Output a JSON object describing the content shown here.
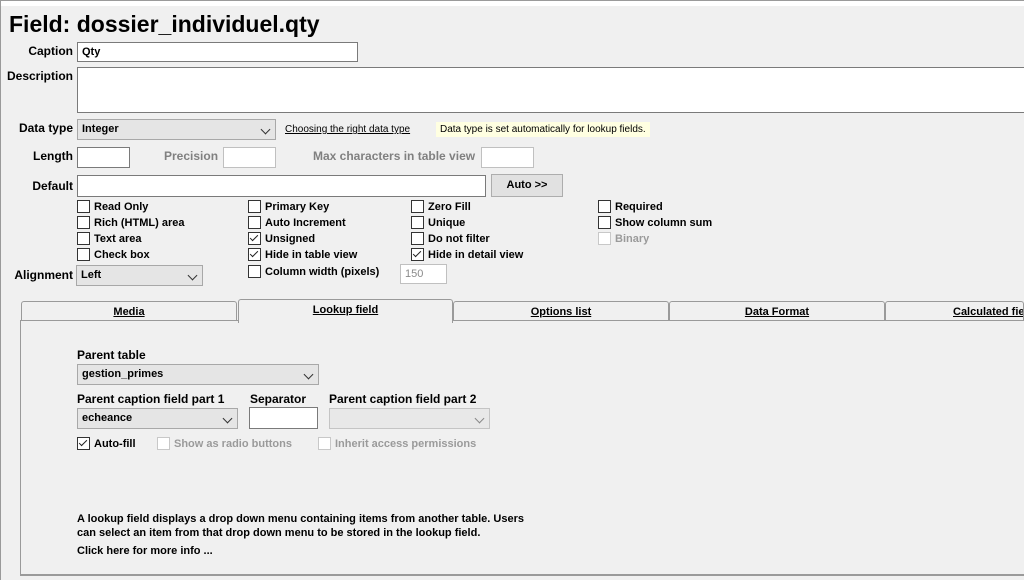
{
  "title": "Field: dossier_individuel.qty",
  "caption": {
    "label": "Caption",
    "value": "Qty"
  },
  "description": {
    "label": "Description",
    "value": ""
  },
  "data_type": {
    "label": "Data type",
    "value": "Integer",
    "link": "Choosing the right data type",
    "hint": "Data type is set automatically for lookup fields."
  },
  "length": {
    "label": "Length",
    "value": ""
  },
  "precision": {
    "label": "Precision",
    "value": ""
  },
  "max_chars": {
    "label": "Max characters in table view",
    "value": ""
  },
  "default": {
    "label": "Default",
    "value": "",
    "auto_button": "Auto >>"
  },
  "checkboxes": {
    "read_only": {
      "label": "Read Only",
      "checked": false
    },
    "rich_html": {
      "label": "Rich (HTML) area",
      "checked": false
    },
    "text_area": {
      "label": "Text area",
      "checked": false
    },
    "check_box": {
      "label": "Check box",
      "checked": false
    },
    "primary_key": {
      "label": "Primary Key",
      "checked": false
    },
    "auto_increment": {
      "label": "Auto Increment",
      "checked": false
    },
    "unsigned": {
      "label": "Unsigned",
      "checked": true
    },
    "hide_table_view": {
      "label": "Hide in table view",
      "checked": true
    },
    "column_width": {
      "label": "Column width (pixels)",
      "checked": false
    },
    "zero_fill": {
      "label": "Zero Fill",
      "checked": false
    },
    "unique": {
      "label": "Unique",
      "checked": false
    },
    "do_not_filter": {
      "label": "Do not filter",
      "checked": false
    },
    "hide_detail_view": {
      "label": "Hide in detail view",
      "checked": true
    },
    "required": {
      "label": "Required",
      "checked": false
    },
    "show_column_sum": {
      "label": "Show column sum",
      "checked": false
    },
    "binary": {
      "label": "Binary",
      "checked": false
    }
  },
  "column_width_value": "150",
  "alignment": {
    "label": "Alignment",
    "value": "Left"
  },
  "tabs": [
    {
      "label": "Media",
      "active": false
    },
    {
      "label": "Lookup field",
      "active": true
    },
    {
      "label": "Options list",
      "active": false
    },
    {
      "label": "Data Format",
      "active": false
    },
    {
      "label": "Calculated fie",
      "active": false
    }
  ],
  "lookup": {
    "parent_table_label": "Parent table",
    "parent_table_value": "gestion_primes",
    "caption_part1_label": "Parent caption field part 1",
    "caption_part1_value": "echeance",
    "separator_label": "Separator",
    "separator_value": "",
    "caption_part2_label": "Parent caption field part 2",
    "caption_part2_value": "",
    "auto_fill": {
      "label": "Auto-fill",
      "checked": true
    },
    "radio_buttons": {
      "label": "Show as radio buttons",
      "checked": false
    },
    "inherit_permissions": {
      "label": "Inherit access permissions",
      "checked": false
    },
    "info_line1": "A lookup field displays a drop down menu containing items from another table. Users",
    "info_line2": "can select an item from that drop down menu to be stored in the lookup field.",
    "more_info": "Click here for more info ..."
  }
}
